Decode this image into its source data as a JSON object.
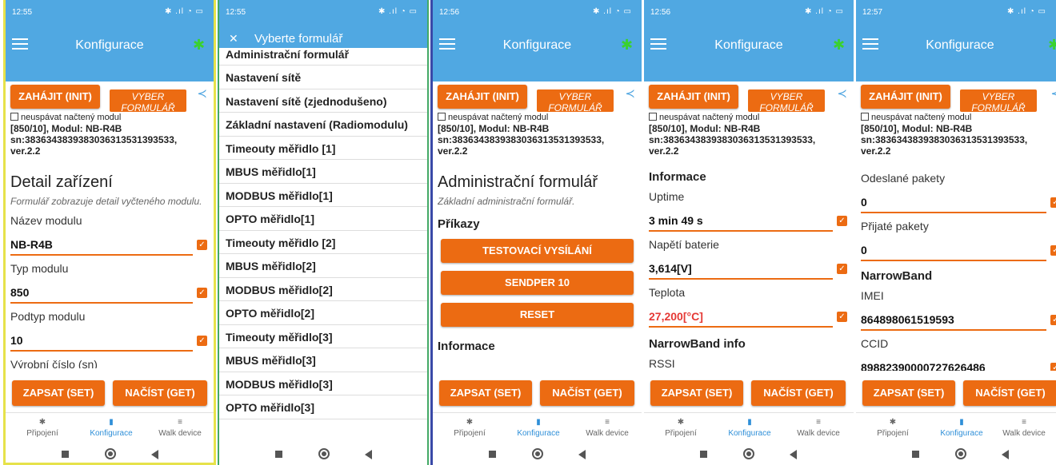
{
  "screens": [
    {
      "status_time": "12:55",
      "title": "Konfigurace",
      "init_label": "ZAHÁJIT (INIT)",
      "vyber_label": "VYBER FORMULÁŘ",
      "checkbox_label": "neuspávat načtený modul",
      "module_line1": "[850/10], Modul: NB-R4B",
      "module_line2": "sn:3836343839383036313531393533,",
      "module_line3": "ver.2.2",
      "heading": "Detail zařízení",
      "description": "Formulář zobrazuje detail vyčteného modulu.",
      "fields": [
        {
          "label": "Název modulu",
          "value": "NB-R4B"
        },
        {
          "label": "Typ modulu",
          "value": "850"
        },
        {
          "label": "Podtyp modulu",
          "value": "10"
        }
      ],
      "cut_label": "Výrobní číslo (sn)",
      "set_label": "ZAPSAT (SET)",
      "get_label": "NAČÍST (GET)"
    },
    {
      "status_time": "12:55",
      "title": "Vyberte formulář",
      "forms": [
        "Administrační formulář",
        "Nastavení sítě",
        "Nastavení sítě (zjednodušeno)",
        "Základní nastavení (Radiomodulu)",
        "Timeouty měřidlo [1]",
        "MBUS měřidlo[1]",
        "MODBUS měřidlo[1]",
        "OPTO měřidlo[1]",
        "Timeouty měřidlo [2]",
        "MBUS měřidlo[2]",
        "MODBUS měřidlo[2]",
        "OPTO měřidlo[2]",
        "Timeouty měřidlo[3]",
        "MBUS měřidlo[3]",
        "MODBUS měřidlo[3]",
        "OPTO měřidlo[3]"
      ]
    },
    {
      "status_time": "12:56",
      "title": "Konfigurace",
      "heading": "Administrační formulář",
      "description": "Základní administrační formulář.",
      "section_commands": "Příkazy",
      "commands": [
        "TESTOVACÍ VYSÍLÁNÍ",
        "SENDPER 10",
        "RESET"
      ],
      "section_info": "Informace"
    },
    {
      "status_time": "12:56",
      "title": "Konfigurace",
      "section_info": "Informace",
      "fields": [
        {
          "label": "Uptime",
          "value": "3 min 49 s"
        },
        {
          "label": "Napětí baterie",
          "value": "3,614[V]"
        },
        {
          "label": "Teplota",
          "value": "27,200[°C]"
        }
      ],
      "section_nb": "NarrowBand info",
      "rssi_label": "RSSI"
    },
    {
      "status_time": "12:57",
      "title": "Konfigurace",
      "fields_top": [
        {
          "label": "Odeslané pakety",
          "value": "0"
        },
        {
          "label": "Přijaté pakety",
          "value": "0"
        }
      ],
      "section_nb": "NarrowBand",
      "fields_nb": [
        {
          "label": "IMEI",
          "value": "864898061519593"
        },
        {
          "label": "CCID",
          "value": "89882390000727626486"
        }
      ]
    }
  ],
  "nav": {
    "connect": "Připojení",
    "config": "Konfigurace",
    "walk": "Walk device"
  },
  "colors": {
    "appbar": "#50a8e2",
    "accent": "#ec6b12",
    "bluetooth": "#3ad12f",
    "temperature_value": "#e53935"
  },
  "icons": {
    "menu": "menu-icon",
    "bluetooth": "bluetooth-icon",
    "share": "share-icon",
    "close": "close-icon"
  }
}
